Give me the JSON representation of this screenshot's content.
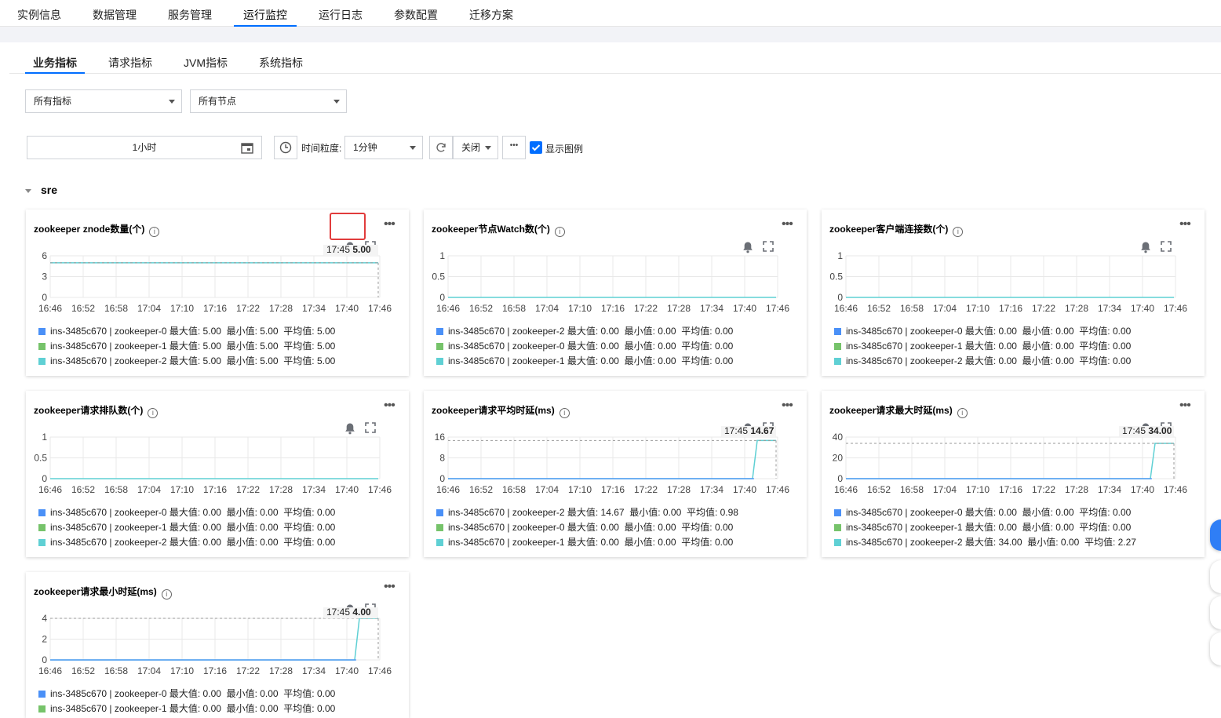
{
  "top_tabs": [
    "实例信息",
    "数据管理",
    "服务管理",
    "运行监控",
    "运行日志",
    "参数配置",
    "迁移方案"
  ],
  "sub_tabs": [
    "业务指标",
    "请求指标",
    "JVM指标",
    "系统指标"
  ],
  "filters": {
    "metric_select": "所有指标",
    "node_select": "所有节点"
  },
  "toolbar": {
    "time_range": "1小时",
    "granularity_label": "时间粒度:",
    "granularity": "1分钟",
    "refresh": "关闭",
    "more": "•••",
    "show_legend": "显示图例"
  },
  "section_title": "sre",
  "x_ticks": [
    "16:46",
    "16:52",
    "16:58",
    "17:04",
    "17:10",
    "17:16",
    "17:22",
    "17:28",
    "17:34",
    "17:40",
    "17:46"
  ],
  "colors": {
    "blue": "#4a90f7",
    "green": "#76c36a",
    "cyan": "#5fd0d4",
    "accent": "#006eff",
    "highlight": "#e13c3c"
  },
  "charts": [
    {
      "title": "zookeeper znode数量(个)",
      "y_ticks": [
        "6",
        "3",
        "0"
      ],
      "ymax": 6,
      "tooltip_time": "17:45",
      "tooltip_value": "5.00",
      "level": 5,
      "spike": false,
      "highlight_bell": true,
      "legend": [
        {
          "name": "ins-3485c670 | zookeeper-0",
          "color": "blue",
          "stats": "最大值: 5.00  最小值: 5.00  平均值: 5.00"
        },
        {
          "name": "ins-3485c670 | zookeeper-1",
          "color": "green",
          "stats": "最大值: 5.00  最小值: 5.00  平均值: 5.00"
        },
        {
          "name": "ins-3485c670 | zookeeper-2",
          "color": "cyan",
          "stats": "最大值: 5.00  最小值: 5.00  平均值: 5.00"
        }
      ]
    },
    {
      "title": "zookeeper节点Watch数(个)",
      "y_ticks": [
        "1",
        "0.5",
        "0"
      ],
      "ymax": 1,
      "tooltip_time": "",
      "tooltip_value": "",
      "level": 0,
      "spike": false,
      "highlight_bell": false,
      "legend": [
        {
          "name": "ins-3485c670 | zookeeper-2",
          "color": "blue",
          "stats": "最大值: 0.00  最小值: 0.00  平均值: 0.00"
        },
        {
          "name": "ins-3485c670 | zookeeper-0",
          "color": "green",
          "stats": "最大值: 0.00  最小值: 0.00  平均值: 0.00"
        },
        {
          "name": "ins-3485c670 | zookeeper-1",
          "color": "cyan",
          "stats": "最大值: 0.00  最小值: 0.00  平均值: 0.00"
        }
      ]
    },
    {
      "title": "zookeeper客户端连接数(个)",
      "y_ticks": [
        "1",
        "0.5",
        "0"
      ],
      "ymax": 1,
      "tooltip_time": "",
      "tooltip_value": "",
      "level": 0,
      "spike": false,
      "highlight_bell": false,
      "legend": [
        {
          "name": "ins-3485c670 | zookeeper-0",
          "color": "blue",
          "stats": "最大值: 0.00  最小值: 0.00  平均值: 0.00"
        },
        {
          "name": "ins-3485c670 | zookeeper-1",
          "color": "green",
          "stats": "最大值: 0.00  最小值: 0.00  平均值: 0.00"
        },
        {
          "name": "ins-3485c670 | zookeeper-2",
          "color": "cyan",
          "stats": "最大值: 0.00  最小值: 0.00  平均值: 0.00"
        }
      ]
    },
    {
      "title": "zookeeper请求排队数(个)",
      "y_ticks": [
        "1",
        "0.5",
        "0"
      ],
      "ymax": 1,
      "tooltip_time": "",
      "tooltip_value": "",
      "level": 0,
      "spike": false,
      "highlight_bell": false,
      "legend": [
        {
          "name": "ins-3485c670 | zookeeper-0",
          "color": "blue",
          "stats": "最大值: 0.00  最小值: 0.00  平均值: 0.00"
        },
        {
          "name": "ins-3485c670 | zookeeper-1",
          "color": "green",
          "stats": "最大值: 0.00  最小值: 0.00  平均值: 0.00"
        },
        {
          "name": "ins-3485c670 | zookeeper-2",
          "color": "cyan",
          "stats": "最大值: 0.00  最小值: 0.00  平均值: 0.00"
        }
      ]
    },
    {
      "title": "zookeeper请求平均时延(ms)",
      "y_ticks": [
        "16",
        "8",
        "0"
      ],
      "ymax": 16,
      "tooltip_time": "17:45",
      "tooltip_value": "14.67",
      "level": 14.67,
      "spike": true,
      "highlight_bell": false,
      "legend": [
        {
          "name": "ins-3485c670 | zookeeper-2",
          "color": "blue",
          "stats": "最大值: 14.67  最小值: 0.00  平均值: 0.98"
        },
        {
          "name": "ins-3485c670 | zookeeper-0",
          "color": "green",
          "stats": "最大值: 0.00  最小值: 0.00  平均值: 0.00"
        },
        {
          "name": "ins-3485c670 | zookeeper-1",
          "color": "cyan",
          "stats": "最大值: 0.00  最小值: 0.00  平均值: 0.00"
        }
      ]
    },
    {
      "title": "zookeeper请求最大时延(ms)",
      "y_ticks": [
        "40",
        "20",
        "0"
      ],
      "ymax": 40,
      "tooltip_time": "17:45",
      "tooltip_value": "34.00",
      "level": 34,
      "spike": true,
      "highlight_bell": false,
      "legend": [
        {
          "name": "ins-3485c670 | zookeeper-0",
          "color": "blue",
          "stats": "最大值: 0.00  最小值: 0.00  平均值: 0.00"
        },
        {
          "name": "ins-3485c670 | zookeeper-1",
          "color": "green",
          "stats": "最大值: 0.00  最小值: 0.00  平均值: 0.00"
        },
        {
          "name": "ins-3485c670 | zookeeper-2",
          "color": "cyan",
          "stats": "最大值: 34.00  最小值: 0.00  平均值: 2.27"
        }
      ]
    },
    {
      "title": "zookeeper请求最小时延(ms)",
      "y_ticks": [
        "4",
        "2",
        "0"
      ],
      "ymax": 4,
      "tooltip_time": "17:45",
      "tooltip_value": "4.00",
      "level": 4,
      "spike": true,
      "highlight_bell": false,
      "legend": [
        {
          "name": "ins-3485c670 | zookeeper-0",
          "color": "blue",
          "stats": "最大值: 0.00  最小值: 0.00  平均值: 0.00"
        },
        {
          "name": "ins-3485c670 | zookeeper-1",
          "color": "green",
          "stats": "最大值: 0.00  最小值: 0.00  平均值: 0.00"
        }
      ]
    }
  ]
}
